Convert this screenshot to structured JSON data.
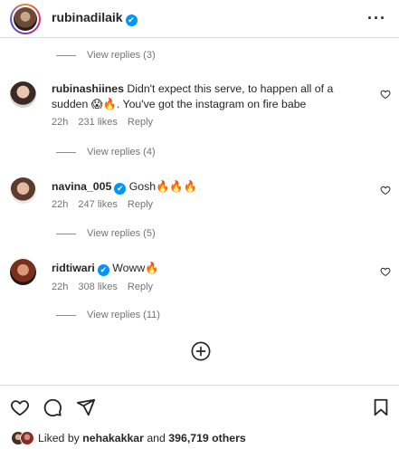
{
  "header": {
    "username": "rubinadilaik",
    "verified_glyph": "✔",
    "more_icon": "more-horizontal-icon"
  },
  "view_replies": [
    {
      "label": "View replies (3)"
    },
    {
      "label": "View replies (4)"
    },
    {
      "label": "View replies (5)"
    },
    {
      "label": "View replies (11)"
    }
  ],
  "comments": [
    {
      "username": "rubinashiines",
      "text": "Didn't expect this serve, to happen all of a sudden 😱🔥. You've got the instagram on fire babe",
      "time": "22h",
      "likes": "231 likes",
      "reply": "Reply",
      "verified": false
    },
    {
      "username": "navina_005",
      "text": "Gosh🔥🔥🔥",
      "time": "22h",
      "likes": "247 likes",
      "reply": "Reply",
      "verified": true
    },
    {
      "username": "ridtiwari",
      "text": "Woww🔥",
      "time": "22h",
      "likes": "308 likes",
      "reply": "Reply",
      "verified": true
    }
  ],
  "actions": {
    "like_icon": "heart-icon",
    "comment_icon": "comment-icon",
    "share_icon": "send-icon",
    "save_icon": "bookmark-icon"
  },
  "likes": {
    "prefix": "Liked by",
    "user": "nehakakkar",
    "middle": "and",
    "count": "396,719 others"
  },
  "colors": {
    "text": "#262626",
    "secondary": "#737373",
    "verified": "#0095f6",
    "border": "#dbdbdb"
  }
}
